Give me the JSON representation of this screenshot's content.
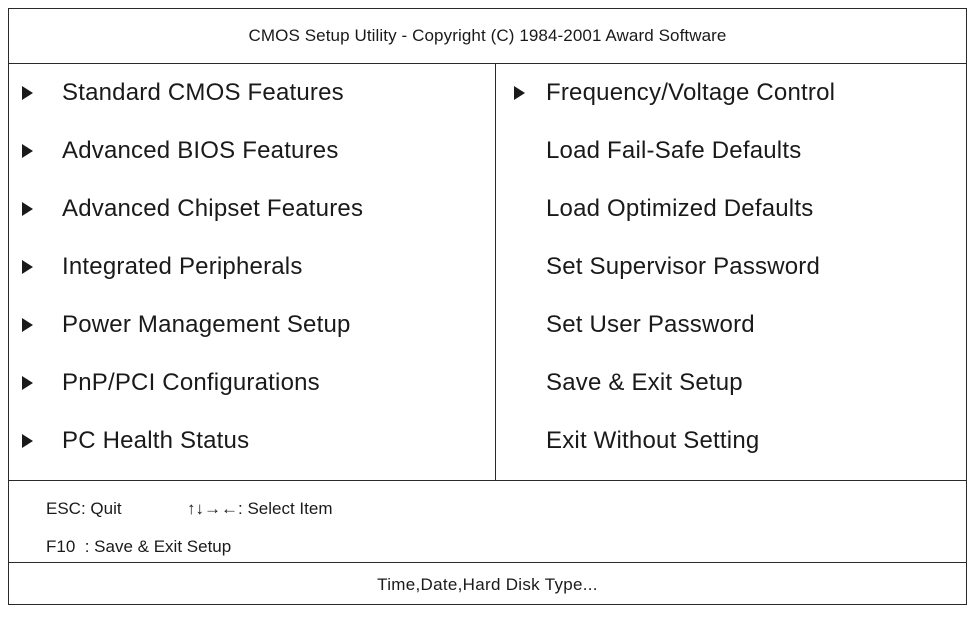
{
  "header": {
    "title": "CMOS Setup Utility - Copyright (C) 1984-2001 Award Software"
  },
  "menu": {
    "left": [
      {
        "label": "Standard CMOS Features",
        "has_submenu": true
      },
      {
        "label": "Advanced BIOS Features",
        "has_submenu": true
      },
      {
        "label": "Advanced Chipset Features",
        "has_submenu": true
      },
      {
        "label": "Integrated Peripherals",
        "has_submenu": true
      },
      {
        "label": "Power Management Setup",
        "has_submenu": true
      },
      {
        "label": "PnP/PCI Configurations",
        "has_submenu": true
      },
      {
        "label": "PC Health Status",
        "has_submenu": true
      }
    ],
    "right": [
      {
        "label": "Frequency/Voltage Control",
        "has_submenu": true
      },
      {
        "label": "Load Fail-Safe Defaults",
        "has_submenu": false
      },
      {
        "label": "Load Optimized Defaults",
        "has_submenu": false
      },
      {
        "label": "Set Supervisor Password",
        "has_submenu": false
      },
      {
        "label": "Set User Password",
        "has_submenu": false
      },
      {
        "label": "Save & Exit Setup",
        "has_submenu": false
      },
      {
        "label": "Exit Without Setting",
        "has_submenu": false
      }
    ]
  },
  "help": {
    "esc": "ESC: Quit",
    "select": "↑↓→←: Select Item",
    "f10": "F10  : Save & Exit Setup"
  },
  "status": {
    "text": "Time,Date,Hard Disk Type..."
  },
  "colors": {
    "foreground": "#1a1a1a",
    "background": "#ffffff",
    "border": "#2a2a2a"
  },
  "icons": {
    "submenu_marker": "triangle-right-icon"
  }
}
